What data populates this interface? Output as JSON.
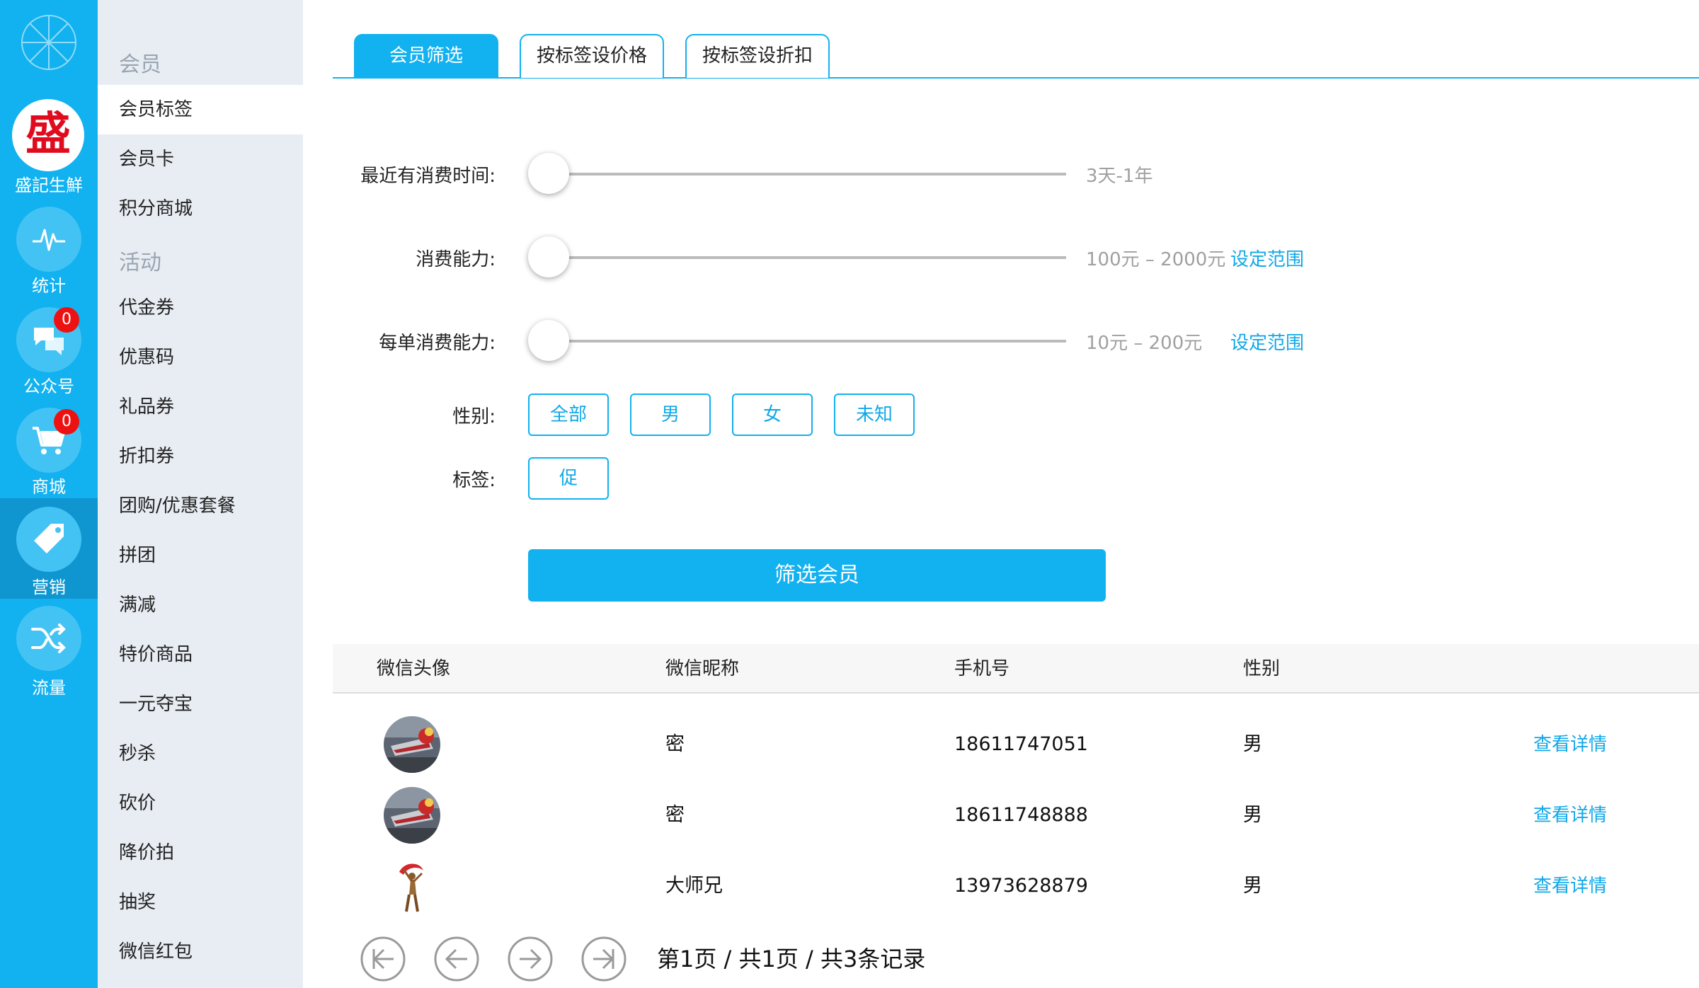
{
  "rail": {
    "brand_char": "盛",
    "brand_name": "盛記生鮮",
    "items": [
      {
        "label": "统计",
        "badge": ""
      },
      {
        "label": "公众号",
        "badge": "0"
      },
      {
        "label": "商城",
        "badge": "0"
      },
      {
        "label": "营销",
        "badge": ""
      },
      {
        "label": "流量",
        "badge": ""
      }
    ]
  },
  "menu": {
    "group_member": "会员",
    "group_activity": "活动",
    "items": [
      "会员标签",
      "会员卡",
      "积分商城",
      "代金券",
      "优惠码",
      "礼品券",
      "折扣券",
      "团购/优惠套餐",
      "拼团",
      "满减",
      "特价商品",
      "一元夺宝",
      "秒杀",
      "砍价",
      "降价拍",
      "抽奖",
      "微信红包"
    ]
  },
  "tabs": [
    "会员筛选",
    "按标签设价格",
    "按标签设折扣"
  ],
  "filters": {
    "recent_label": "最近有消费时间:",
    "recent_value": "3天-1年",
    "ability_label": "消费能力:",
    "ability_value": "100元 – 2000元",
    "ability_link": "设定范围",
    "order_label": "每单消费能力:",
    "order_value": "10元 – 200元",
    "order_link": "设定范围",
    "gender_label": "性别:",
    "gender_options": [
      "全部",
      "男",
      "女",
      "未知"
    ],
    "tag_label": "标签:",
    "tag_options": [
      "促"
    ],
    "submit": "筛选会员"
  },
  "table": {
    "headers": [
      "微信头像",
      "微信昵称",
      "手机号",
      "性别"
    ],
    "rows": [
      {
        "nickname": "密",
        "phone": "18611747051",
        "gender": "男",
        "action": "查看详情"
      },
      {
        "nickname": "密",
        "phone": "18611748888",
        "gender": "男",
        "action": "查看详情"
      },
      {
        "nickname": "大师兄",
        "phone": "13973628879",
        "gender": "男",
        "action": "查看详情"
      }
    ]
  },
  "pager": {
    "text": "第1页 / 共1页 / 共3条记录"
  },
  "colors": {
    "accent": "#12b1f0",
    "rail_active": "#0f95cf",
    "menu_bg": "#e8edf3",
    "badge": "#ee1111",
    "link": "#12a8e8"
  }
}
